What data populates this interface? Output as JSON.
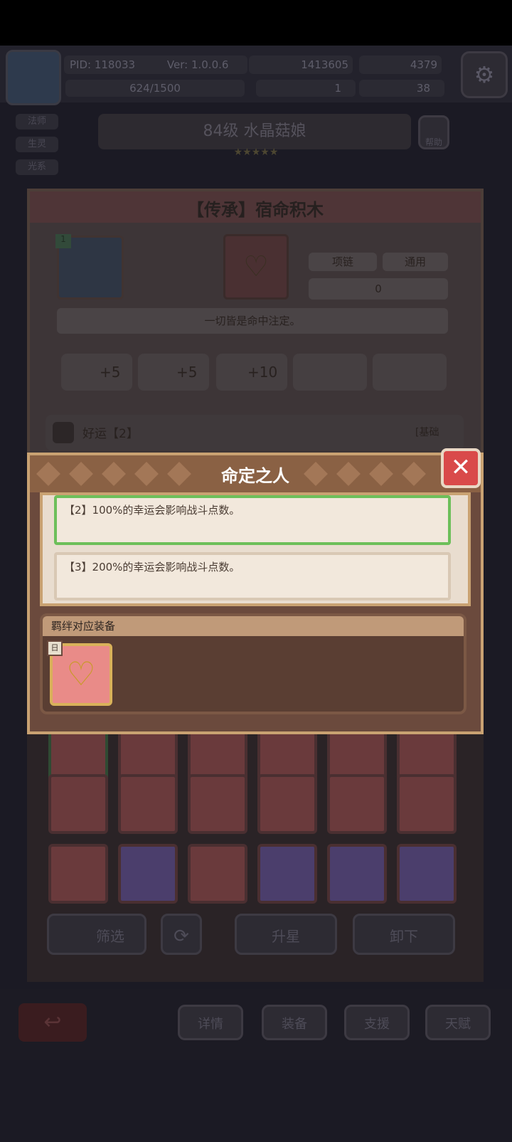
{
  "hud": {
    "pid": "PID: 118033",
    "version": "Ver: 1.0.0.6",
    "gold": "1413605",
    "gems": "4379",
    "exp": "624/1500",
    "clover": "1",
    "key": "38"
  },
  "character": {
    "level_name": "84级 水晶菇娘",
    "stars": "★★★★★",
    "help": "帮助",
    "left_tabs": [
      "法师",
      "生灵",
      "光系"
    ]
  },
  "item_panel": {
    "title": "【传承】宿命积木",
    "badge": "1",
    "type": "项链",
    "category": "通用",
    "count": "0",
    "quote": "一切皆是命中注定。",
    "stats": [
      "+5",
      "+5",
      "+10"
    ],
    "skill": "好运【2】",
    "skill_tag": "[基础"
  },
  "popup": {
    "title": "命定之人",
    "effects": [
      "【2】100%的幸运会影响战斗点数。",
      "【3】200%的幸运会影响战斗点数。"
    ],
    "bond_label": "羁绊对应装备",
    "bond_badge": "日"
  },
  "bottom_buttons": {
    "filter": "筛选",
    "upgrade": "升星",
    "unequip": "卸下"
  },
  "nav_tabs": [
    "详情",
    "装备",
    "支援",
    "天赋"
  ],
  "colors": {
    "popup_border": "#c9a272",
    "selected": "#6dbf5a",
    "close": "#d94a4a"
  },
  "icons": [
    "back-icon",
    "gear-icon",
    "heart-icon",
    "star-icon",
    "close-icon"
  ]
}
